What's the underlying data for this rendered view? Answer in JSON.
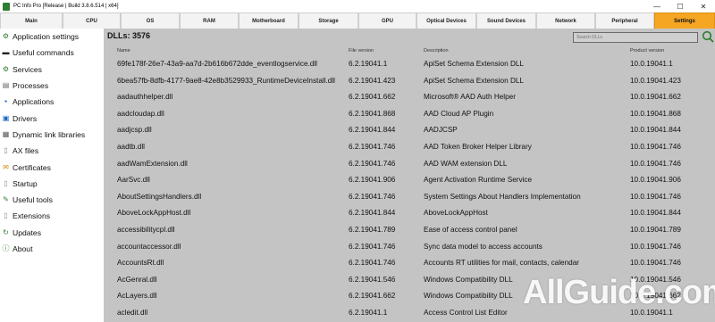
{
  "window": {
    "title": "PC Info Pro [Release | Build 3.8.6.514 | x64]",
    "minimize": "—",
    "maximize": "☐",
    "close": "✕"
  },
  "tabs": [
    {
      "label": "Main",
      "active": false
    },
    {
      "label": "CPU",
      "active": false
    },
    {
      "label": "OS",
      "active": false
    },
    {
      "label": "RAM",
      "active": false
    },
    {
      "label": "Motherboard",
      "active": false
    },
    {
      "label": "Storage",
      "active": false
    },
    {
      "label": "GPU",
      "active": false
    },
    {
      "label": "Optical Devices",
      "active": false
    },
    {
      "label": "Sound Devices",
      "active": false
    },
    {
      "label": "Network",
      "active": false
    },
    {
      "label": "Peripheral",
      "active": false
    },
    {
      "label": "Settings",
      "active": true
    }
  ],
  "sidebar": {
    "items": [
      {
        "label": "Application settings",
        "icon": "gear-icon"
      },
      {
        "label": "Useful commands",
        "icon": "terminal-icon"
      },
      {
        "label": "Services",
        "icon": "services-icon"
      },
      {
        "label": "Processes",
        "icon": "processes-icon"
      },
      {
        "label": "Applications",
        "icon": "applications-icon"
      },
      {
        "label": "Drivers",
        "icon": "drivers-icon"
      },
      {
        "label": "Dynamic link libraries",
        "icon": "dll-icon"
      },
      {
        "label": "AX files",
        "icon": "file-icon"
      },
      {
        "label": "Certificates",
        "icon": "certificate-icon"
      },
      {
        "label": "Startup",
        "icon": "startup-icon"
      },
      {
        "label": "Useful tools",
        "icon": "tools-icon"
      },
      {
        "label": "Extensions",
        "icon": "extensions-icon"
      },
      {
        "label": "Updates",
        "icon": "refresh-icon"
      },
      {
        "label": "About",
        "icon": "info-icon"
      }
    ]
  },
  "main": {
    "title": "DLLs: 3576",
    "search_placeholder": "Search DLLs",
    "columns": [
      "Name",
      "File version",
      "Description",
      "Product version"
    ],
    "rows": [
      [
        "69fe178f-26e7-43a9-aa7d-2b616b672dde_eventlogservice.dll",
        "6.2.19041.1",
        "ApiSet Schema Extension DLL",
        "10.0.19041.1"
      ],
      [
        "6bea57fb-8dfb-4177-9ae8-42e8b3529933_RuntimeDeviceInstall.dll",
        "6.2.19041.423",
        "ApiSet Schema Extension DLL",
        "10.0.19041.423"
      ],
      [
        "aadauthhelper.dll",
        "6.2.19041.662",
        "Microsoft® AAD Auth Helper",
        "10.0.19041.662"
      ],
      [
        "aadcloudap.dll",
        "6.2.19041.868",
        "AAD Cloud AP Plugin",
        "10.0.19041.868"
      ],
      [
        "aadjcsp.dll",
        "6.2.19041.844",
        "AADJCSP",
        "10.0.19041.844"
      ],
      [
        "aadtb.dll",
        "6.2.19041.746",
        "AAD Token Broker Helper Library",
        "10.0.19041.746"
      ],
      [
        "aadWamExtension.dll",
        "6.2.19041.746",
        "AAD WAM extension DLL",
        "10.0.19041.746"
      ],
      [
        "AarSvc.dll",
        "6.2.19041.906",
        "Agent Activation Runtime Service",
        "10.0.19041.906"
      ],
      [
        "AboutSettingsHandlers.dll",
        "6.2.19041.746",
        "System Settings About Handlers Implementation",
        "10.0.19041.746"
      ],
      [
        "AboveLockAppHost.dll",
        "6.2.19041.844",
        "AboveLockAppHost",
        "10.0.19041.844"
      ],
      [
        "accessibilitycpl.dll",
        "6.2.19041.789",
        "Ease of access  control panel",
        "10.0.19041.789"
      ],
      [
        "accountaccessor.dll",
        "6.2.19041.746",
        "Sync data model to access accounts",
        "10.0.19041.746"
      ],
      [
        "AccountsRt.dll",
        "6.2.19041.746",
        "Accounts RT utilities for mail, contacts, calendar",
        "10.0.19041.746"
      ],
      [
        "AcGenral.dll",
        "6.2.19041.546",
        "Windows Compatibility DLL",
        "10.0.19041.546"
      ],
      [
        "AcLayers.dll",
        "6.2.19041.662",
        "Windows Compatibility DLL",
        "10.0.19041.662"
      ],
      [
        "acledit.dll",
        "6.2.19041.1",
        "Access Control List Editor",
        "10.0.19041.1"
      ]
    ]
  },
  "watermark": "AllGuide.com",
  "colors": {
    "active_tab": "#f5a623",
    "list_background": "#c4c4c4",
    "icon_accent": "#2e7d32"
  }
}
